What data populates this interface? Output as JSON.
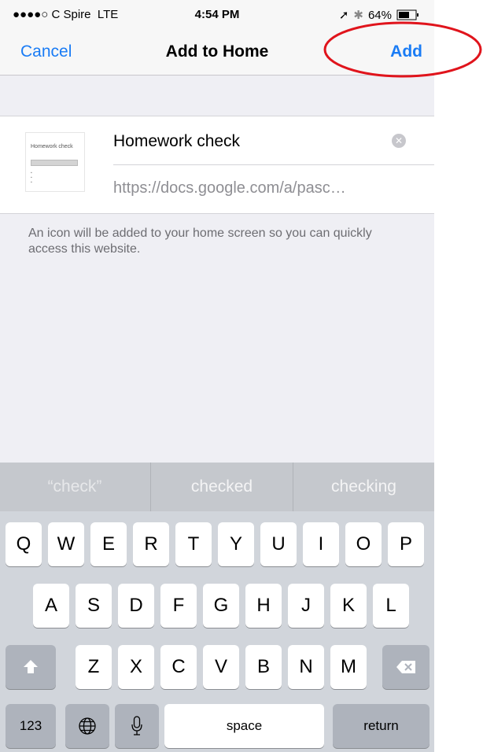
{
  "status": {
    "carrier": "●●●●○ C Spire",
    "network": "LTE",
    "time": "4:54 PM",
    "battery": "64%"
  },
  "nav": {
    "cancel": "Cancel",
    "title": "Add to Home",
    "add": "Add"
  },
  "form": {
    "name_value": "Homework check",
    "url": "https://docs.google.com/a/pasc…"
  },
  "thumbnail": {
    "title": "Homework check"
  },
  "help_text": "An icon will be added to your home screen so you can quickly access this website.",
  "suggestions": [
    "“check”",
    "checked",
    "checking"
  ],
  "keyboard": {
    "row1": [
      "Q",
      "W",
      "E",
      "R",
      "T",
      "Y",
      "U",
      "I",
      "O",
      "P"
    ],
    "row2": [
      "A",
      "S",
      "D",
      "F",
      "G",
      "H",
      "J",
      "K",
      "L"
    ],
    "row3": [
      "Z",
      "X",
      "C",
      "V",
      "B",
      "N",
      "M"
    ],
    "num_label": "123",
    "space_label": "space",
    "return_label": "return"
  },
  "colors": {
    "accent": "#1a7cf5",
    "annotation": "#e0141c"
  }
}
